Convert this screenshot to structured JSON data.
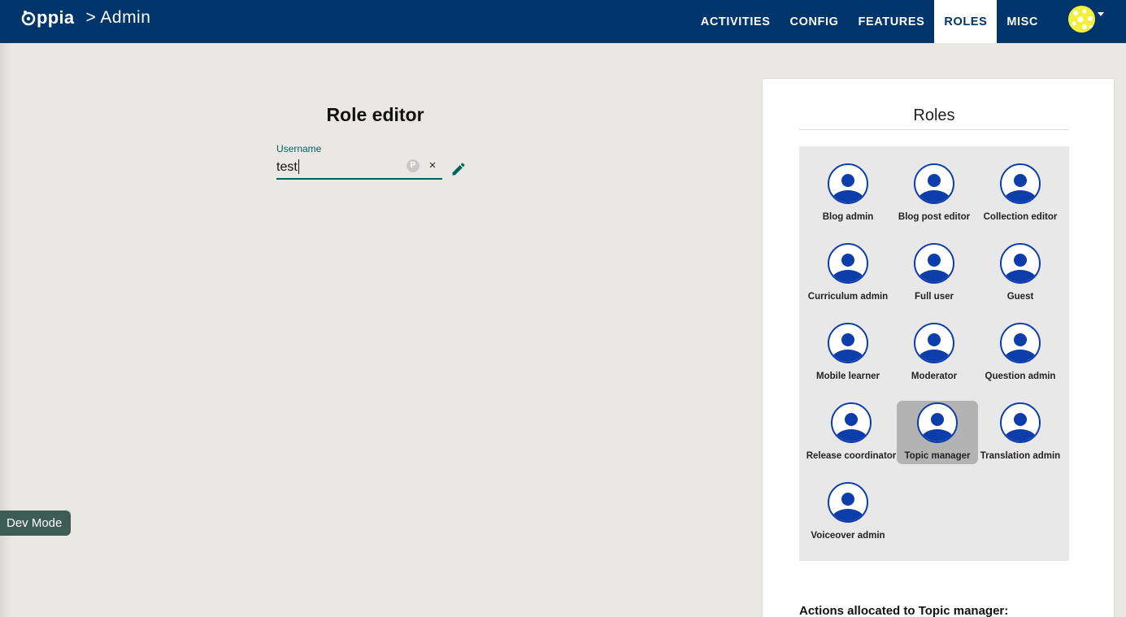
{
  "header": {
    "logo_text": "ppia",
    "breadcrumb": "> Admin",
    "nav": [
      {
        "label": "ACTIVITIES",
        "active": false
      },
      {
        "label": "CONFIG",
        "active": false
      },
      {
        "label": "FEATURES",
        "active": false
      },
      {
        "label": "ROLES",
        "active": true
      },
      {
        "label": "MISC",
        "active": false
      }
    ],
    "colors": {
      "bar": "#00356b",
      "avatar": "#f3ef3e"
    }
  },
  "role_editor": {
    "title": "Role editor",
    "username_label": "Username",
    "username_value": "test",
    "pm_icon": "P",
    "clear_icon": "×"
  },
  "dev_mode": {
    "label": "Dev Mode"
  },
  "roles_panel": {
    "title": "Roles",
    "roles": [
      {
        "label": "Blog admin",
        "selected": false
      },
      {
        "label": "Blog post editor",
        "selected": false
      },
      {
        "label": "Collection editor",
        "selected": false
      },
      {
        "label": "Curriculum admin",
        "selected": false
      },
      {
        "label": "Full user",
        "selected": false
      },
      {
        "label": "Guest",
        "selected": false
      },
      {
        "label": "Mobile learner",
        "selected": false
      },
      {
        "label": "Moderator",
        "selected": false
      },
      {
        "label": "Question admin",
        "selected": false
      },
      {
        "label": "Release coordinator",
        "selected": false
      },
      {
        "label": "Topic manager",
        "selected": true
      },
      {
        "label": "Translation admin",
        "selected": false
      },
      {
        "label": "Voiceover admin",
        "selected": false
      }
    ],
    "actions_title": "Actions allocated to Topic manager:",
    "accent_color": "#0c3daa"
  }
}
